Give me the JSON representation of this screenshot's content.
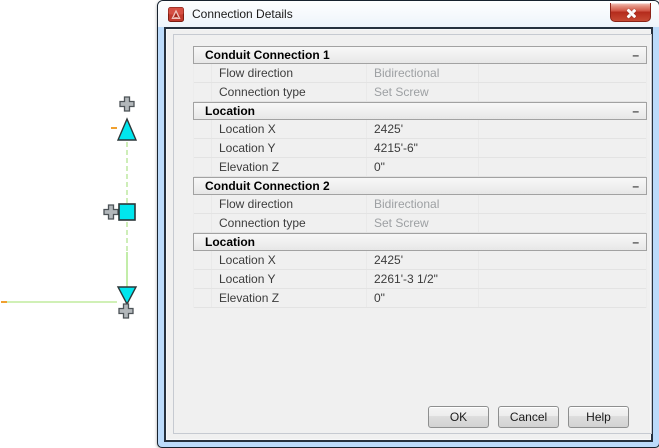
{
  "window": {
    "title": "Connection Details"
  },
  "icons": {
    "app_icon": "autocad-logo",
    "close_icon": "x-cross",
    "collapse_icon": "–"
  },
  "colors": {
    "frame_blue": "#bcdbfb",
    "close_red": "#c0392b",
    "grip_cyan": "#00e6ee",
    "line_green": "#b4e794",
    "tick_orange": "#f0a030",
    "panel_gray": "#f0f0f0"
  },
  "sections": [
    {
      "title": "Conduit Connection 1",
      "rows": [
        {
          "label": "Flow direction",
          "value": "Bidirectional",
          "readonly": true
        },
        {
          "label": "Connection type",
          "value": "Set Screw",
          "readonly": true
        }
      ]
    },
    {
      "title": "Location",
      "rows": [
        {
          "label": "Location X",
          "value": "2425'",
          "readonly": false
        },
        {
          "label": "Location Y",
          "value": "4215'-6\"",
          "readonly": false
        },
        {
          "label": "Elevation Z",
          "value": "0\"",
          "readonly": false
        }
      ]
    },
    {
      "title": "Conduit Connection 2",
      "rows": [
        {
          "label": "Flow direction",
          "value": "Bidirectional",
          "readonly": true
        },
        {
          "label": "Connection type",
          "value": "Set Screw",
          "readonly": true
        }
      ]
    },
    {
      "title": "Location",
      "rows": [
        {
          "label": "Location X",
          "value": "2425'",
          "readonly": false
        },
        {
          "label": "Location Y",
          "value": "2261'-3 1/2\"",
          "readonly": false
        },
        {
          "label": "Elevation Z",
          "value": "0\"",
          "readonly": false
        }
      ]
    }
  ],
  "buttons": {
    "ok": "OK",
    "cancel": "Cancel",
    "help": "Help"
  },
  "drawing": {
    "entities": [
      "conduit-run-vertical",
      "conduit-run-horizontal",
      "connection-grip-top-triangle",
      "connection-node-square",
      "connection-grip-bottom-triangle"
    ]
  }
}
